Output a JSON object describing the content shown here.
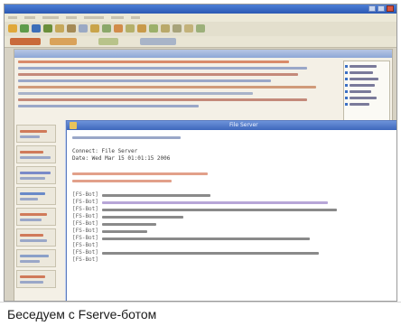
{
  "caption": "Беседуем с Fserve-ботом",
  "chat_window": {
    "title": "File Server",
    "intro": [
      "Connect: File Server",
      "Date: Wed Mar 15 01:01:15 2006"
    ],
    "nick": "[FS-Bot]",
    "rows_count": 10
  },
  "colors": {
    "accent": "#3e67bb",
    "toolbar": "#e3dfcd",
    "highlight_red": "#d97a5a"
  }
}
